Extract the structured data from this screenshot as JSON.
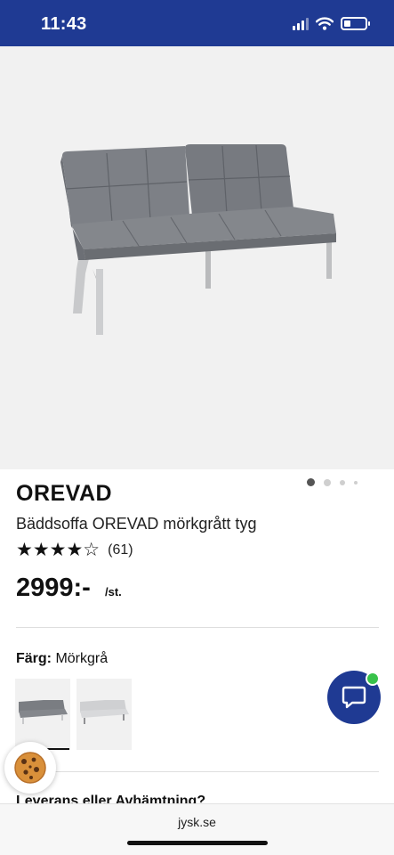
{
  "status_bar": {
    "time": "11:43",
    "icons": [
      "signal-icon",
      "wifi-icon",
      "battery-icon"
    ]
  },
  "gallery": {
    "image": "sofa-image",
    "total_images": 4,
    "active_index": 1
  },
  "product": {
    "brand": "OREVAD",
    "subtitle": "Bäddsoffa OREVAD mörkgrått tyg",
    "rating": 4,
    "rating_max": 5,
    "stars": "★★★★☆",
    "review_count": "(61)",
    "price": "2999:-",
    "unit": "/st."
  },
  "color_selector": {
    "label": "Färg:",
    "value": "Mörkgrå",
    "swatches": [
      {
        "name": "Mörkgrå",
        "color": "#7a7d82",
        "selected": true
      },
      {
        "name": "Ljusgrå",
        "color": "#cfd0d2",
        "selected": false
      }
    ]
  },
  "chat": {
    "icon": "chat-bubble-icon",
    "status_color": "#38c24a"
  },
  "cookie": {
    "icon": "cookie-icon"
  },
  "delivery": {
    "heading": "Leverans eller Avhämtning?"
  },
  "browser": {
    "url": "jysk.se"
  },
  "colors": {
    "brand_blue": "#1f3a93",
    "online_green": "#38c24a"
  }
}
